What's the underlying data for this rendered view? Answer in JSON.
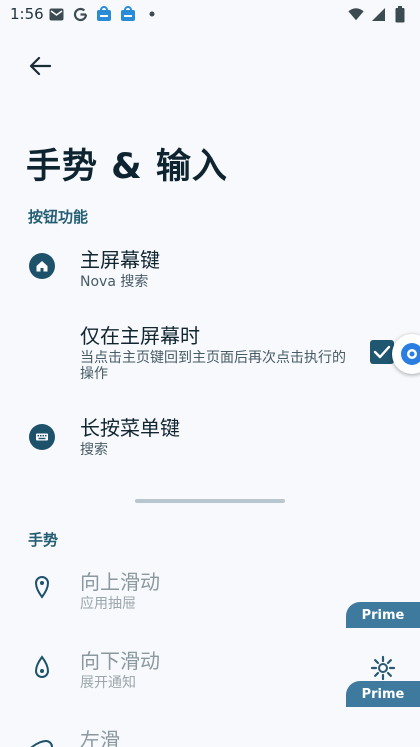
{
  "status_bar": {
    "time": "1:56",
    "left_icons": [
      "gmail-icon",
      "google-icon",
      "notification-icon",
      "notification-icon",
      "dot-icon"
    ],
    "right_icons": [
      "wifi-icon",
      "signal-icon",
      "battery-icon"
    ]
  },
  "header": {
    "back_icon": "arrow-left-icon",
    "title": "手势 & 输入"
  },
  "sections": {
    "buttons": {
      "header": "按钮功能",
      "items": [
        {
          "title": "主屏幕键",
          "subtitle": "Nova 搜索",
          "icon": "home-icon"
        },
        {
          "title": "仅在主屏幕时",
          "subtitle": "当点击主页键回到主页面后再次点击执行的操作",
          "checked": true
        },
        {
          "title": "长按菜单键",
          "subtitle": "搜索",
          "icon": "keyboard-icon"
        }
      ]
    },
    "gestures": {
      "header": "手势",
      "items": [
        {
          "title": "向上滑动",
          "subtitle": "应用抽屉",
          "icon": "swipe-up-icon"
        },
        {
          "title": "向下滑动",
          "subtitle": "展开通知",
          "icon": "swipe-down-icon"
        },
        {
          "title": "左滑",
          "subtitle": "",
          "icon": "swipe-left-icon"
        }
      ]
    }
  },
  "prime_labels": [
    "Prime",
    "Prime"
  ],
  "colors": {
    "accent": "#1f5670",
    "section_header": "#245e73",
    "prime_badge": "#3e7a9d"
  }
}
